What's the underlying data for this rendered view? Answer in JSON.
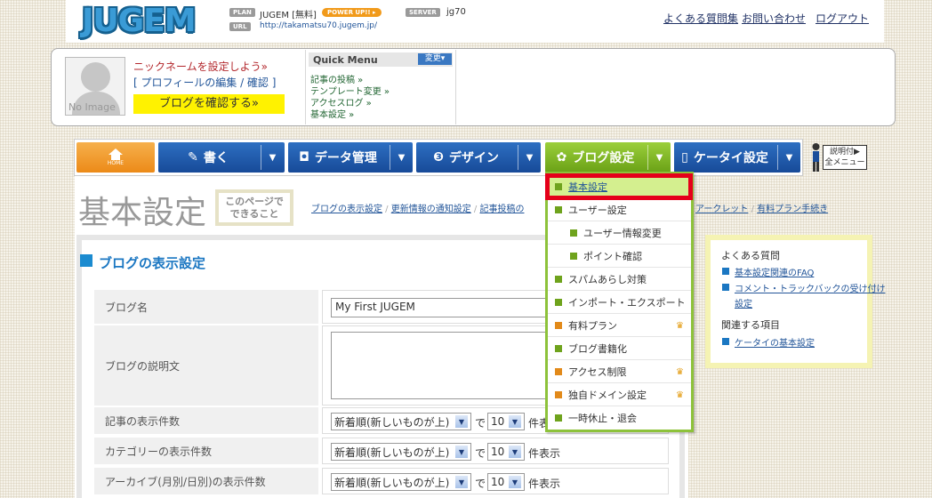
{
  "header": {
    "logo": "JUGEM",
    "plan_tag": "PLAN",
    "plan": "JUGEM [無料]",
    "powerup": "POWER UP!! ▸",
    "server_tag": "SERVER",
    "server": "jg70",
    "url_tag": "URL",
    "url": "http://takamatsu70.jugem.jp/",
    "links": [
      "よくある質問集",
      "お問い合わせ",
      "ログアウト"
    ]
  },
  "profile": {
    "avatar_text": "No Image",
    "nickname_prompt": "ニックネームを設定しよう»",
    "edit_open": "[ ",
    "edit_link": "プロフィールの編集 / 確認",
    "edit_close": " ]",
    "check_button": "ブログを確認する»"
  },
  "quick_menu": {
    "title": "Quick Menu",
    "change": "変更▾",
    "items": [
      "記事の投稿 »",
      "テンプレート変更 »",
      "アクセスログ »",
      "基本設定 »"
    ]
  },
  "nav": {
    "home": "HOME",
    "write": "書く",
    "data": "データ管理",
    "design": "デザイン",
    "blog_settings": "ブログ設定",
    "mobile": "ケータイ設定",
    "all_menu": "説明付▶\n全メニュー"
  },
  "page": {
    "title": "基本設定",
    "this_page": "このページで\nできること",
    "sub_links": [
      "ブログの表示設定",
      "更新情報の通知設定",
      "記事投稿の"
    ],
    "sub_links_right": [
      "アークレット",
      "有料プラン手続き"
    ]
  },
  "section": {
    "title": "ブログの表示設定",
    "rows": [
      {
        "label": "ブログ名",
        "value": "My First JUGEM"
      },
      {
        "label": "ブログの説明文",
        "value": ""
      },
      {
        "label": "記事の表示件数",
        "select": "新着順(新しいものが上)",
        "de": "で",
        "count": "10",
        "suffix": "件表示"
      },
      {
        "label": "カテゴリーの表示件数",
        "select": "新着順(新しいものが上)",
        "de": "で",
        "count": "10",
        "suffix": "件表示"
      },
      {
        "label": "アーカイブ(月別/日別)の表示件数",
        "select": "新着順(新しいものが上)",
        "de": "で",
        "count": "10",
        "suffix": "件表示"
      }
    ]
  },
  "dropdown": {
    "items": [
      {
        "label": "基本設定",
        "highlighted": true
      },
      {
        "label": "ユーザー設定"
      },
      {
        "label": "ユーザー情報変更",
        "sub": true
      },
      {
        "label": "ポイント確認",
        "sub": true
      },
      {
        "label": "スパムあらし対策"
      },
      {
        "label": "インポート・エクスポート"
      },
      {
        "label": "有料プラン",
        "premium": true
      },
      {
        "label": "ブログ書籍化"
      },
      {
        "label": "アクセス制限",
        "premium": true
      },
      {
        "label": "独自ドメイン設定",
        "premium": true
      },
      {
        "label": "一時休止・退会"
      }
    ]
  },
  "faq": {
    "title": "よくある質問",
    "links": [
      "基本設定関連のFAQ",
      "コメント・トラックバックの受け付け",
      "設定"
    ],
    "related_title": "関連する項目",
    "related": [
      "ケータイの基本設定"
    ]
  },
  "colors": {
    "accent_blue": "#1b77c2",
    "nav_blue": "#2d6fc2",
    "nav_green": "#8dc23a",
    "highlight_red": "#e5001a",
    "home_orange": "#f19a1a",
    "check_yellow": "#fff200"
  }
}
